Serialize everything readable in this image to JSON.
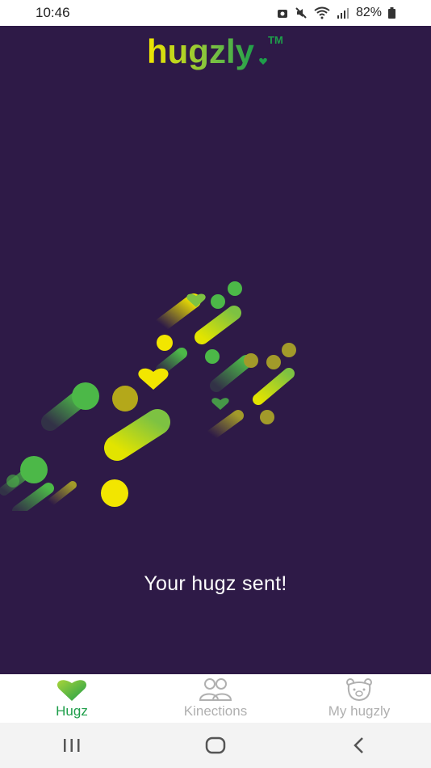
{
  "status_bar": {
    "time": "10:46",
    "battery": "82%"
  },
  "app": {
    "logo_text": "hugzly",
    "trademark": "TM"
  },
  "main": {
    "message": "Your hugz sent!"
  },
  "tabs": [
    {
      "label": "Hugz",
      "icon": "heart-icon",
      "active": true
    },
    {
      "label": "Kinections",
      "icon": "people-icon",
      "active": false
    },
    {
      "label": "My hugzly",
      "icon": "bear-icon",
      "active": false
    }
  ],
  "nav": {
    "buttons": [
      "recent-apps",
      "home",
      "back"
    ]
  },
  "colors": {
    "background": "#2e1a47",
    "accent_green": "#1e9e4a",
    "accent_yellow": "#f2e600",
    "inactive": "#b0b0b0"
  }
}
